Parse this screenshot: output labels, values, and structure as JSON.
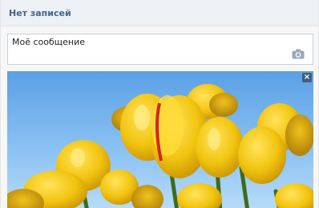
{
  "header": {
    "title": "Нет записей"
  },
  "composer": {
    "text": "Моё сообщение",
    "attach_icon": "camera-icon"
  },
  "attachment": {
    "image": "yellow-tulips-photo",
    "remove_icon": "close-icon",
    "remove_glyph": "×"
  },
  "colors": {
    "header_bg": "#edf0f4",
    "header_text": "#43658f",
    "border": "#c7d0da",
    "close_bg": "#3f5f80"
  }
}
